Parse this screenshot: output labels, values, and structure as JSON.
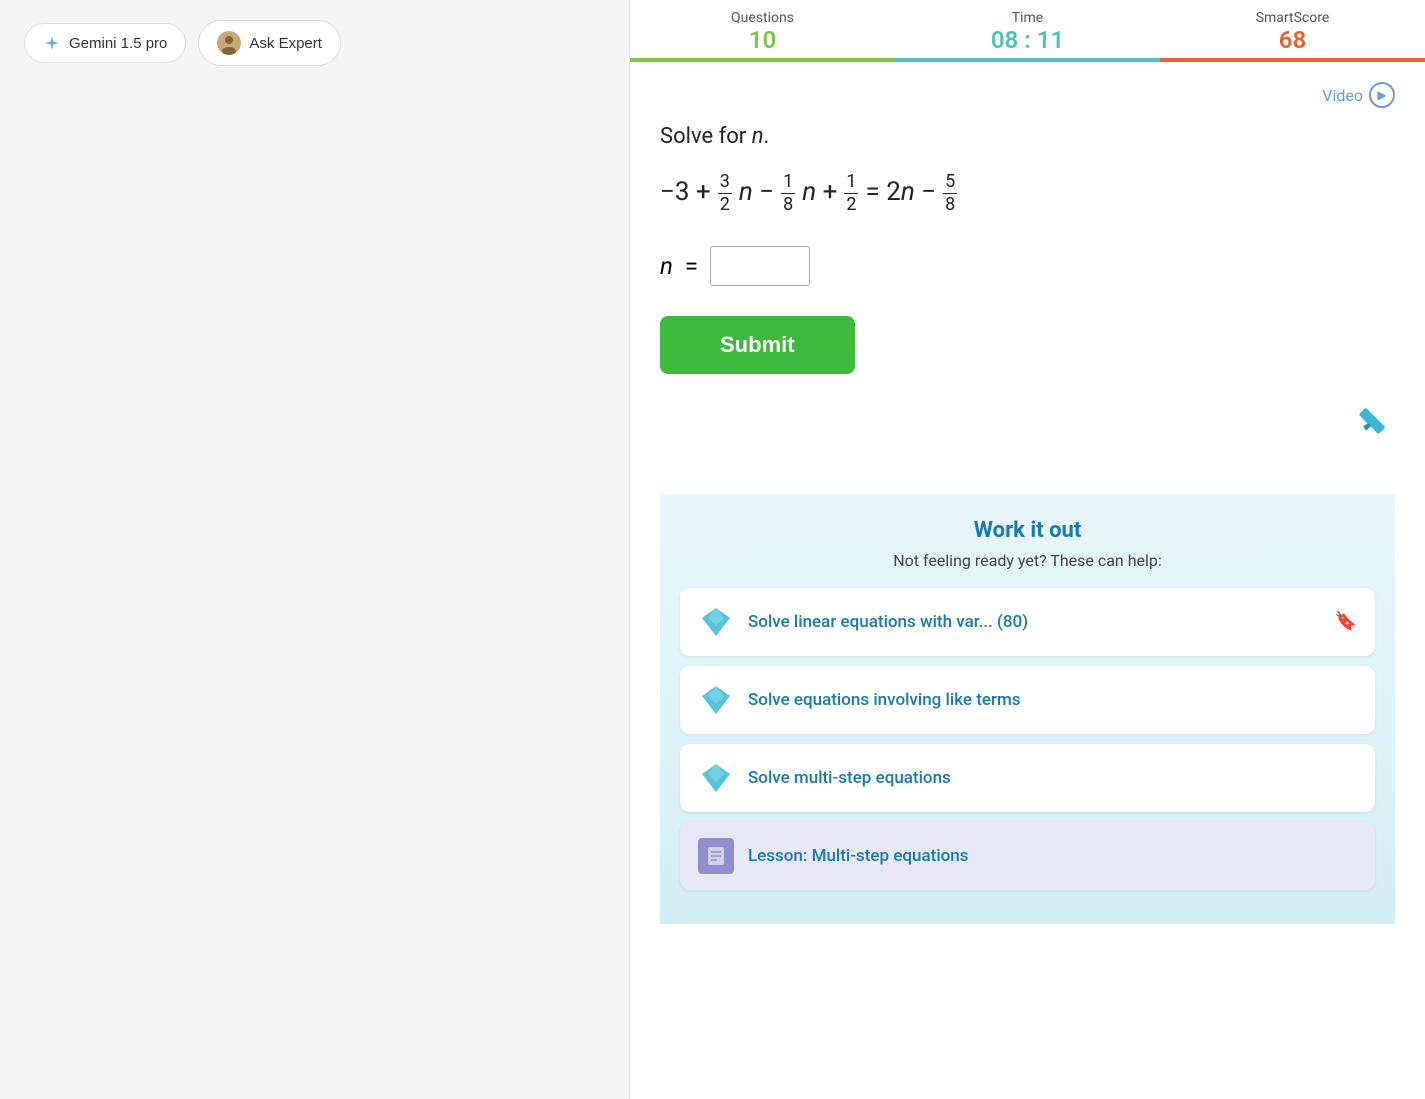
{
  "left_panel": {
    "gemini_button": "Gemini 1.5 pro",
    "ask_expert_button": "Ask Expert"
  },
  "stats": {
    "questions_label": "Questions",
    "questions_value": "10",
    "time_label": "Time",
    "time_value": "08 : 11",
    "smartscore_label": "SmartScore",
    "smartscore_value": "68"
  },
  "video": {
    "label": "Video"
  },
  "problem": {
    "heading": "Solve for n.",
    "equation_display": "-3 + (3/2)n - (1/8)n + (1/2) = 2n - (5/8)",
    "n_label": "n",
    "equals": "=",
    "input_placeholder": ""
  },
  "submit_button": "Submit",
  "work_it_out": {
    "title": "Work it out",
    "subtitle": "Not feeling ready yet? These can help:",
    "resources": [
      {
        "text": "Solve linear equations with var... (80)",
        "has_bookmark": true,
        "type": "diamond"
      },
      {
        "text": "Solve equations involving like terms",
        "has_bookmark": false,
        "type": "diamond"
      },
      {
        "text": "Solve multi-step equations",
        "has_bookmark": false,
        "type": "diamond"
      },
      {
        "text": "Lesson: Multi-step equations",
        "has_bookmark": false,
        "type": "lesson"
      }
    ]
  }
}
